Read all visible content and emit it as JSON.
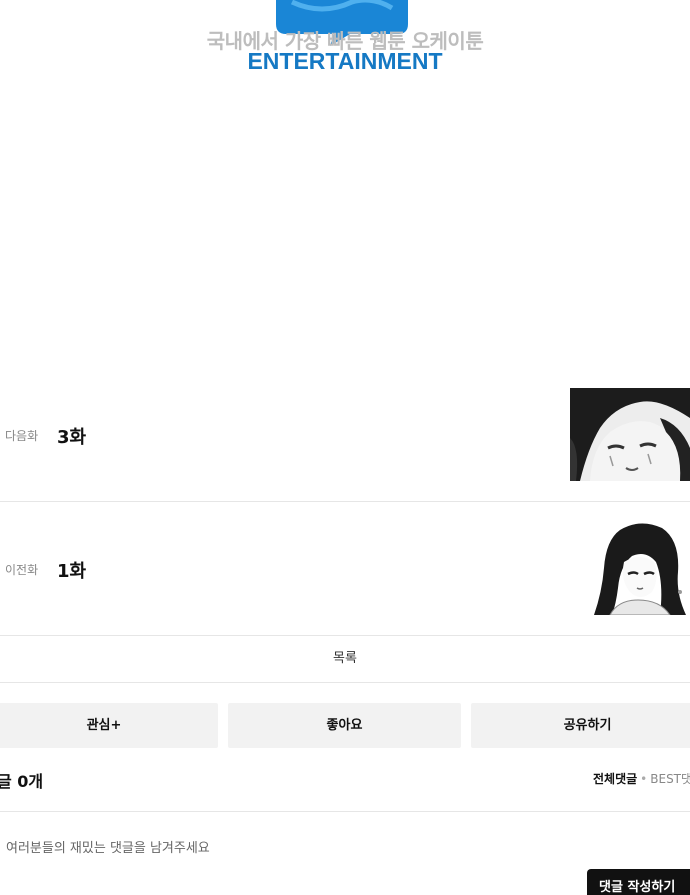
{
  "banner": {
    "slogan": "국내에서 가장 빠른 웹툰 오케이툰",
    "brand": "ENTERTAINMENT",
    "brand_color": "#1579c4",
    "bubble_color": "#1a86d6"
  },
  "episodes": {
    "next": {
      "type_label": "다음화",
      "title": "3화",
      "thumb_icon": "manga-thumbnail-crying-girl"
    },
    "prev": {
      "type_label": "이전화",
      "title": "1화",
      "thumb_icon": "manga-thumbnail-girl"
    }
  },
  "list_button": {
    "label": "목록"
  },
  "actions": {
    "interest": "관심+",
    "like": "좋아요",
    "share": "공유하기"
  },
  "comments": {
    "count_label": "글 0개",
    "sort_all": "전체댓글",
    "sort_separator": "•",
    "sort_best": "BEST댓",
    "placeholder": "여러분들의 재밌는 댓글을 남겨주세요",
    "write_button": "댓글 작성하기"
  }
}
